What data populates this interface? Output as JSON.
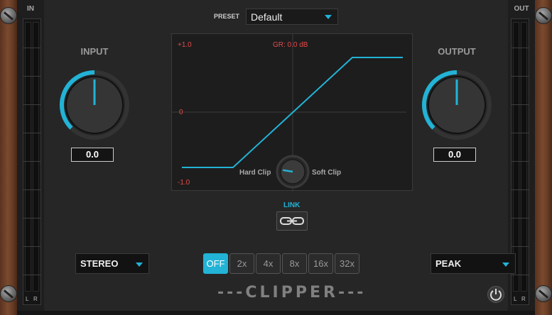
{
  "meters": {
    "in_title": "IN",
    "out_title": "OUT",
    "left_channel": "L",
    "right_channel": "R"
  },
  "preset": {
    "label": "PRESET",
    "value": "Default"
  },
  "input": {
    "label": "INPUT",
    "value": "0.0",
    "level": 0.5
  },
  "output": {
    "label": "OUTPUT",
    "value": "0.0",
    "level": 0.5
  },
  "graph": {
    "top_label": "+1.0",
    "mid_label": "0",
    "bottom_label": "-1.0",
    "gr_readout": "GR: 0.0 dB",
    "hard_label": "Hard Clip",
    "soft_label": "Soft Clip",
    "clip_shape": 0.2
  },
  "link": {
    "label": "LINK"
  },
  "mode": {
    "value": "STEREO"
  },
  "oversampling": {
    "options": [
      "OFF",
      "2x",
      "4x",
      "8x",
      "16x",
      "32x"
    ],
    "selected": "OFF"
  },
  "detection": {
    "value": "PEAK"
  },
  "brand": {
    "name": "---CLIPPER---"
  },
  "colors": {
    "accent": "#22b3d6",
    "graph_label": "#e34a4a",
    "wood": "#6a3e26"
  }
}
